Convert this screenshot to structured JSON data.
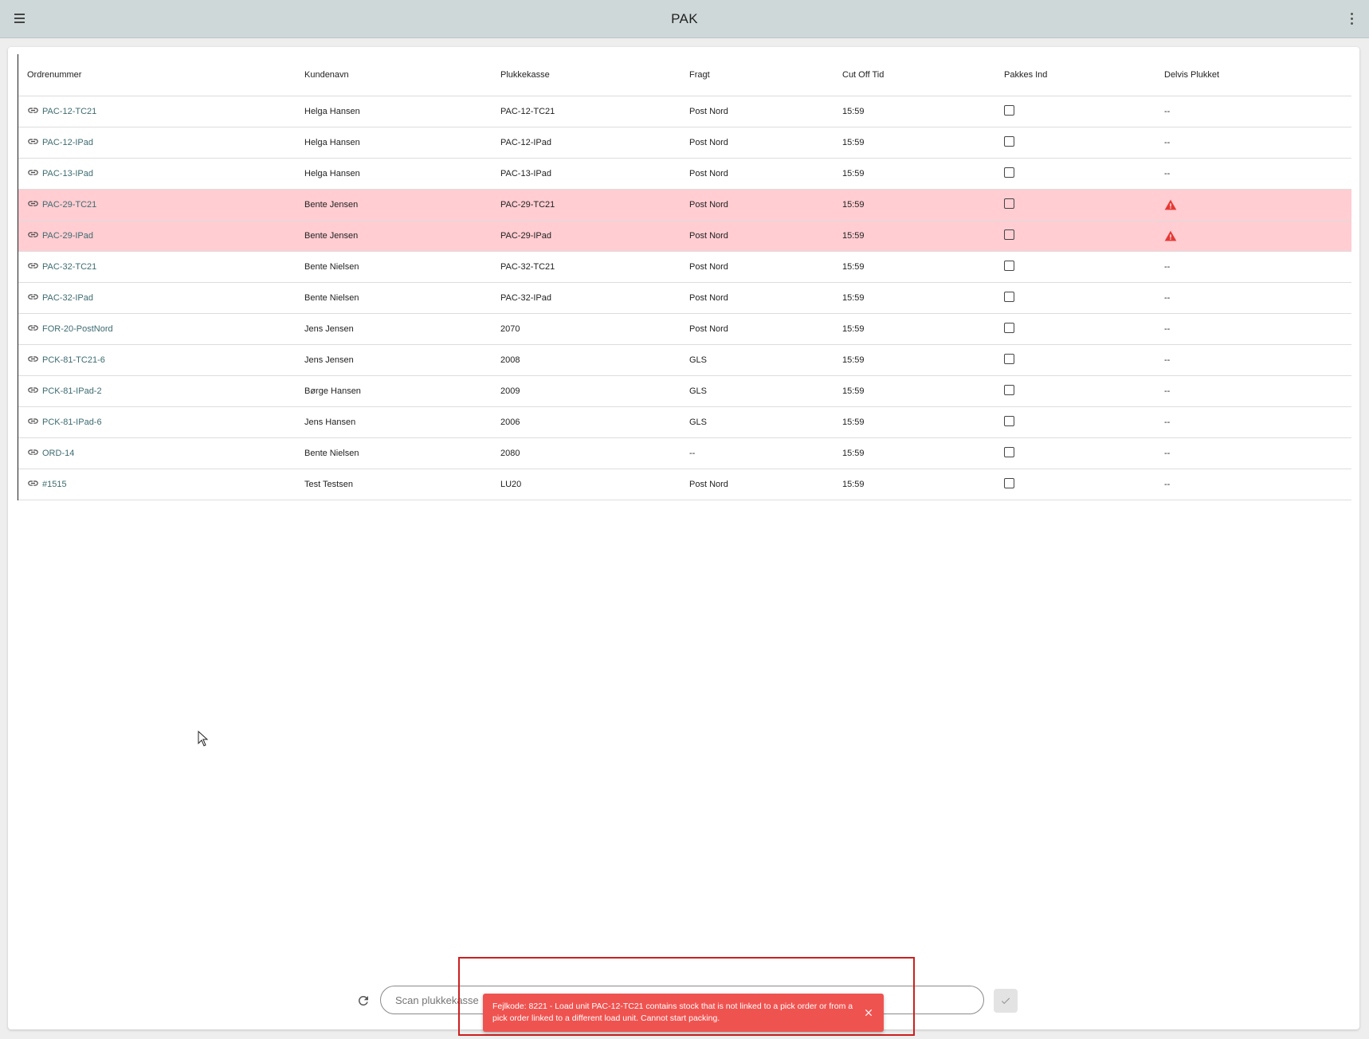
{
  "app": {
    "title": "PAK"
  },
  "table": {
    "columns": [
      "Ordrenummer",
      "Kundenavn",
      "Plukkekasse",
      "Fragt",
      "Cut Off Tid",
      "Pakkes Ind",
      "Delvis Plukket"
    ],
    "rows": [
      {
        "order": "PAC-12-TC21",
        "customer": "Helga Hansen",
        "box": "PAC-12-TC21",
        "freight": "Post Nord",
        "cutoff": "15:59",
        "packed": false,
        "partial": "--",
        "error": false
      },
      {
        "order": "PAC-12-IPad",
        "customer": "Helga Hansen",
        "box": "PAC-12-IPad",
        "freight": "Post Nord",
        "cutoff": "15:59",
        "packed": false,
        "partial": "--",
        "error": false
      },
      {
        "order": "PAC-13-IPad",
        "customer": "Helga Hansen",
        "box": "PAC-13-IPad",
        "freight": "Post Nord",
        "cutoff": "15:59",
        "packed": false,
        "partial": "--",
        "error": false
      },
      {
        "order": "PAC-29-TC21",
        "customer": "Bente Jensen",
        "box": "PAC-29-TC21",
        "freight": "Post Nord",
        "cutoff": "15:59",
        "packed": false,
        "partial": "warning",
        "error": true
      },
      {
        "order": "PAC-29-IPad",
        "customer": "Bente Jensen",
        "box": "PAC-29-IPad",
        "freight": "Post Nord",
        "cutoff": "15:59",
        "packed": false,
        "partial": "warning",
        "error": true
      },
      {
        "order": "PAC-32-TC21",
        "customer": "Bente Nielsen",
        "box": "PAC-32-TC21",
        "freight": "Post Nord",
        "cutoff": "15:59",
        "packed": false,
        "partial": "--",
        "error": false
      },
      {
        "order": "PAC-32-IPad",
        "customer": "Bente Nielsen",
        "box": "PAC-32-IPad",
        "freight": "Post Nord",
        "cutoff": "15:59",
        "packed": false,
        "partial": "--",
        "error": false
      },
      {
        "order": "FOR-20-PostNord",
        "customer": "Jens Jensen",
        "box": "2070",
        "freight": "Post Nord",
        "cutoff": "15:59",
        "packed": false,
        "partial": "--",
        "error": false
      },
      {
        "order": "PCK-81-TC21-6",
        "customer": "Jens Jensen",
        "box": "2008",
        "freight": "GLS",
        "cutoff": "15:59",
        "packed": false,
        "partial": "--",
        "error": false
      },
      {
        "order": "PCK-81-IPad-2",
        "customer": "Børge Hansen",
        "box": "2009",
        "freight": "GLS",
        "cutoff": "15:59",
        "packed": false,
        "partial": "--",
        "error": false
      },
      {
        "order": "PCK-81-IPad-6",
        "customer": "Jens Hansen",
        "box": "2006",
        "freight": "GLS",
        "cutoff": "15:59",
        "packed": false,
        "partial": "--",
        "error": false
      },
      {
        "order": "ORD-14",
        "customer": "Bente Nielsen",
        "box": "2080",
        "freight": "--",
        "cutoff": "15:59",
        "packed": false,
        "partial": "--",
        "error": false
      },
      {
        "order": "#1515",
        "customer": "Test Testsen",
        "box": "LU20",
        "freight": "Post Nord",
        "cutoff": "15:59",
        "packed": false,
        "partial": "--",
        "error": false
      }
    ]
  },
  "scan": {
    "placeholder": "Scan plukkekasse"
  },
  "snackbar": {
    "message": "Fejlkode: 8221 - Load unit PAC-12-TC21 contains stock that is not linked to a pick order or from a pick order linked to a different load unit. Cannot start packing."
  },
  "colors": {
    "appbar": "#cfd8d8",
    "error_row": "#ffcdd2",
    "snackbar": "#ef5350",
    "link": "#3d6b70",
    "warning": "#e53935"
  }
}
